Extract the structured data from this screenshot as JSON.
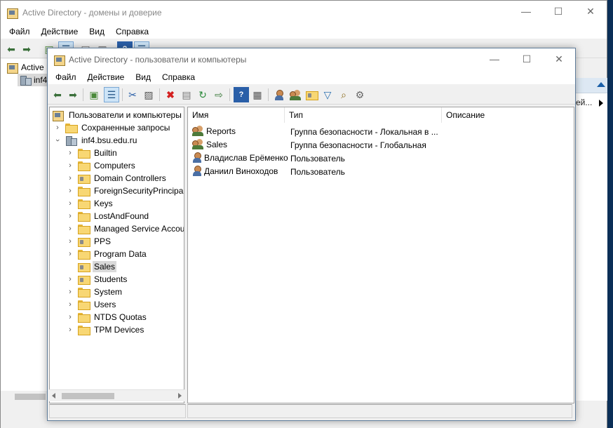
{
  "background_window": {
    "title": "Active Directory - домены и доверие",
    "menu": [
      "Файл",
      "Действие",
      "Вид",
      "Справка"
    ],
    "tree": [
      {
        "label": "Active D",
        "icon": "ad-domains-icon"
      },
      {
        "label": "inf4",
        "icon": "domain-icon"
      }
    ],
    "right_item": "ей..."
  },
  "window": {
    "title": "Active Directory - пользователи и компьютеры",
    "menu": [
      "Файл",
      "Действие",
      "Вид",
      "Справка"
    ],
    "toolbar": [
      "back-icon",
      "forward-icon",
      "up-folder-icon",
      "show-tree-icon",
      "cut-icon",
      "paste-icon",
      "delete-icon",
      "properties-icon",
      "refresh-icon",
      "export-icon",
      "help-icon",
      "show-console-icon",
      "new-user-icon",
      "new-group-icon",
      "new-ou-icon",
      "filter-icon",
      "find-icon",
      "add-member-icon"
    ],
    "tree": {
      "root": "Пользователи и компьютеры Active Directory",
      "saved_queries": "Сохраненные запросы",
      "domain": "inf4.bsu.edu.ru",
      "children": [
        {
          "label": "Builtin",
          "icon": "folder",
          "expandable": true
        },
        {
          "label": "Computers",
          "icon": "folder",
          "expandable": true
        },
        {
          "label": "Domain Controllers",
          "icon": "ou",
          "expandable": true
        },
        {
          "label": "ForeignSecurityPrincipals",
          "icon": "folder",
          "expandable": true
        },
        {
          "label": "Keys",
          "icon": "folder",
          "expandable": true
        },
        {
          "label": "LostAndFound",
          "icon": "folder",
          "expandable": true
        },
        {
          "label": "Managed Service Accounts",
          "icon": "folder",
          "expandable": true
        },
        {
          "label": "PPS",
          "icon": "ou",
          "expandable": true
        },
        {
          "label": "Program Data",
          "icon": "folder",
          "expandable": true
        },
        {
          "label": "Sales",
          "icon": "ou",
          "expandable": false,
          "selected": true
        },
        {
          "label": "Students",
          "icon": "ou",
          "expandable": true
        },
        {
          "label": "System",
          "icon": "folder",
          "expandable": true
        },
        {
          "label": "Users",
          "icon": "folder",
          "expandable": true
        },
        {
          "label": "NTDS Quotas",
          "icon": "folder",
          "expandable": true
        },
        {
          "label": "TPM Devices",
          "icon": "folder",
          "expandable": true
        }
      ]
    },
    "list": {
      "columns": [
        "Имя",
        "Тип",
        "Описание"
      ],
      "rows": [
        {
          "name": "Reports",
          "type": "Группа безопасности - Локальная в ...",
          "description": "",
          "icon": "group"
        },
        {
          "name": "Sales",
          "type": "Группа безопасности - Глобальная",
          "description": "",
          "icon": "group"
        },
        {
          "name": "Владислав Ерёменко",
          "type": "Пользователь",
          "description": "",
          "icon": "user"
        },
        {
          "name": "Даниил Виноходов",
          "type": "Пользователь",
          "description": "",
          "icon": "user"
        }
      ]
    }
  },
  "colors": {
    "selection": "#d9d9d9",
    "folder": "#f8d774",
    "desktop": "#0b2f57"
  }
}
